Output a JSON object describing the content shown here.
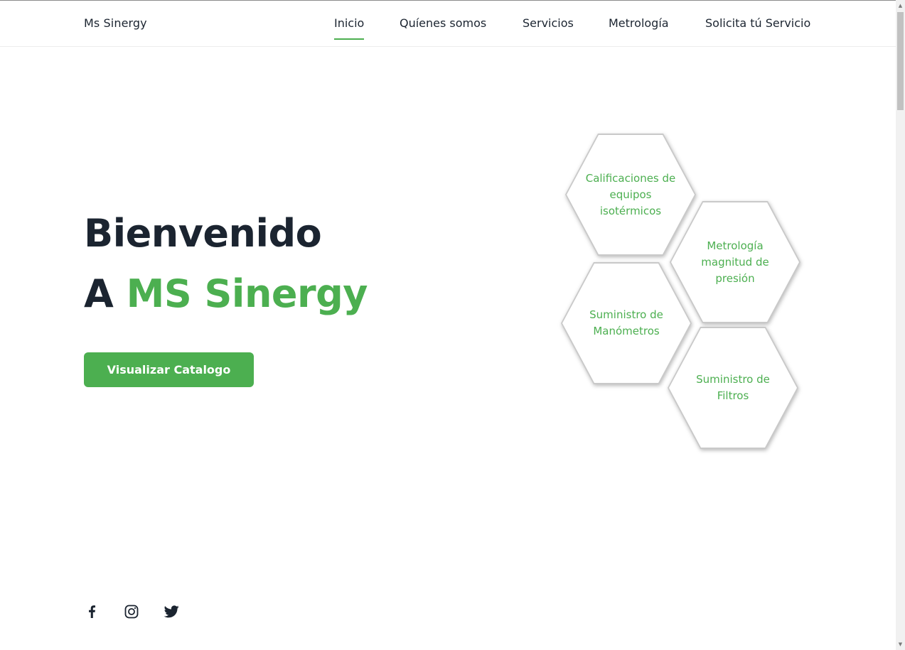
{
  "brand": {
    "name": "Ms Sinergy",
    "accent_color": "#4caf50",
    "text_color": "#1b2430"
  },
  "nav": {
    "items": [
      {
        "label": "Inicio",
        "active": true
      },
      {
        "label": "Quíenes somos",
        "active": false
      },
      {
        "label": "Servicios",
        "active": false
      },
      {
        "label": "Metrología",
        "active": false
      },
      {
        "label": "Solicita tú Servicio",
        "active": false
      }
    ]
  },
  "hero": {
    "title_line1": "Bienvenido",
    "title_prefix": "A",
    "title_accent": "MS Sinergy",
    "cta_label": "Visualizar Catalogo"
  },
  "services": [
    {
      "label": "Calificaciones de equipos isotérmicos"
    },
    {
      "label": "Metrología magnitud de presión"
    },
    {
      "label": "Suministro de Manómetros"
    },
    {
      "label": "Suministro de Filtros"
    }
  ],
  "social": [
    {
      "icon": "facebook-icon"
    },
    {
      "icon": "instagram-icon"
    },
    {
      "icon": "twitter-icon"
    }
  ]
}
